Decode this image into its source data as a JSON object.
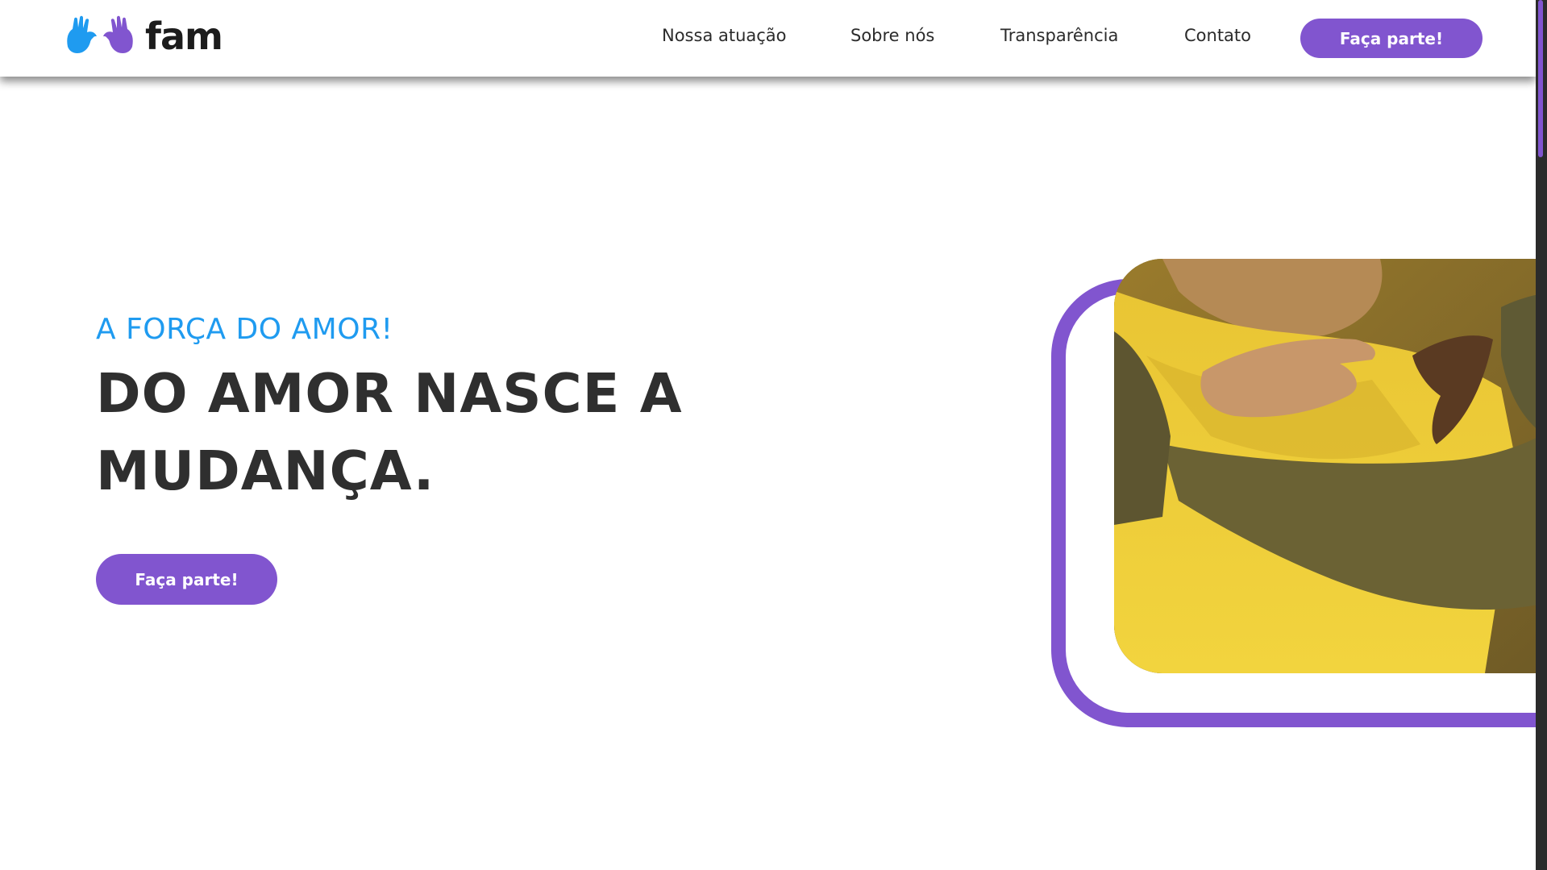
{
  "header": {
    "brand": "fam",
    "logo_icon": "hands-heart-icon",
    "nav": [
      {
        "label": "Nossa atuação"
      },
      {
        "label": "Sobre nós"
      },
      {
        "label": "Transparência"
      },
      {
        "label": "Contato"
      }
    ],
    "cta_label": "Faça parte!"
  },
  "hero": {
    "eyebrow": "A FORÇA DO AMOR!",
    "title_line1": "DO AMOR NASCE A",
    "title_line2": "MUDANÇA.",
    "cta_label": "Faça parte!",
    "image_icon": "hug-photo"
  },
  "colors": {
    "accent": "#8155cf",
    "eyebrow": "#1f9bf0",
    "title": "#2f2f2f"
  }
}
